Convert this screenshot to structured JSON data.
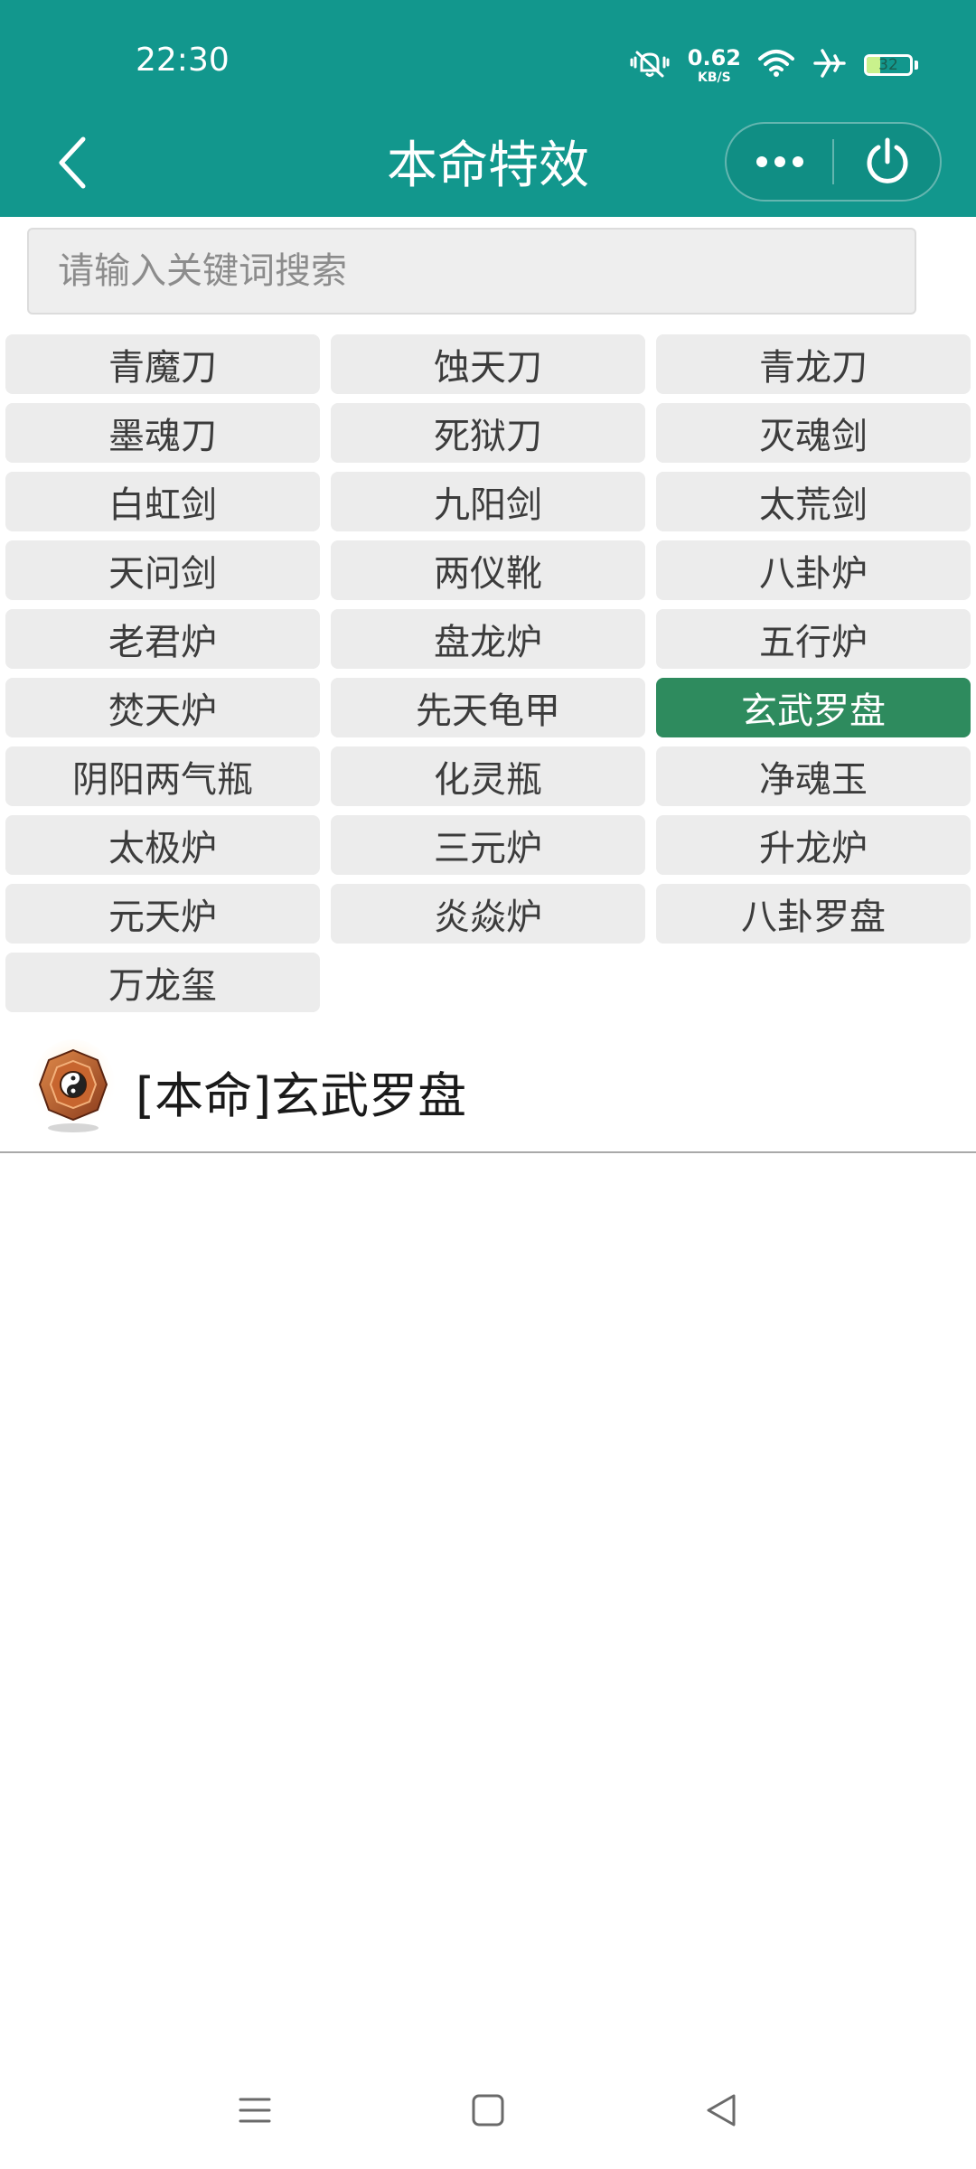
{
  "status_bar": {
    "time": "22:30",
    "net_speed_value": "0.62",
    "net_speed_unit": "KB/S",
    "battery": "32",
    "icons": [
      "mute-vibrate-icon",
      "wifi-icon",
      "airplane-icon",
      "battery-icon"
    ]
  },
  "header": {
    "title": "本命特效",
    "back_icon": "chevron-left-icon",
    "more_icon": "more-dots-icon",
    "close_icon": "power-icon",
    "background_color": "#12978d"
  },
  "search": {
    "placeholder": "请输入关键词搜索",
    "value": ""
  },
  "items": [
    {
      "label": "青魔刀"
    },
    {
      "label": "蚀天刀"
    },
    {
      "label": "青龙刀"
    },
    {
      "label": "墨魂刀"
    },
    {
      "label": "死狱刀"
    },
    {
      "label": "灭魂剑"
    },
    {
      "label": "白虹剑"
    },
    {
      "label": "九阳剑"
    },
    {
      "label": "太荒剑"
    },
    {
      "label": "天问剑"
    },
    {
      "label": "两仪靴"
    },
    {
      "label": "八卦炉"
    },
    {
      "label": "老君炉"
    },
    {
      "label": "盘龙炉"
    },
    {
      "label": "五行炉"
    },
    {
      "label": "焚天炉"
    },
    {
      "label": "先天龟甲"
    },
    {
      "label": "玄武罗盘"
    },
    {
      "label": "阴阳两气瓶"
    },
    {
      "label": "化灵瓶"
    },
    {
      "label": "净魂玉"
    },
    {
      "label": "太极炉"
    },
    {
      "label": "三元炉"
    },
    {
      "label": "升龙炉"
    },
    {
      "label": "元天炉"
    },
    {
      "label": "炎焱炉"
    },
    {
      "label": "八卦罗盘"
    },
    {
      "label": "万龙玺"
    }
  ],
  "selected_item": "玄武罗盘",
  "selected_color": "#2e8b5e",
  "result": {
    "title": "[本命]玄武罗盘",
    "icon": "compass-item-icon"
  },
  "nav_bar": {
    "icons": [
      "menu-icon",
      "home-icon",
      "back-icon"
    ]
  }
}
